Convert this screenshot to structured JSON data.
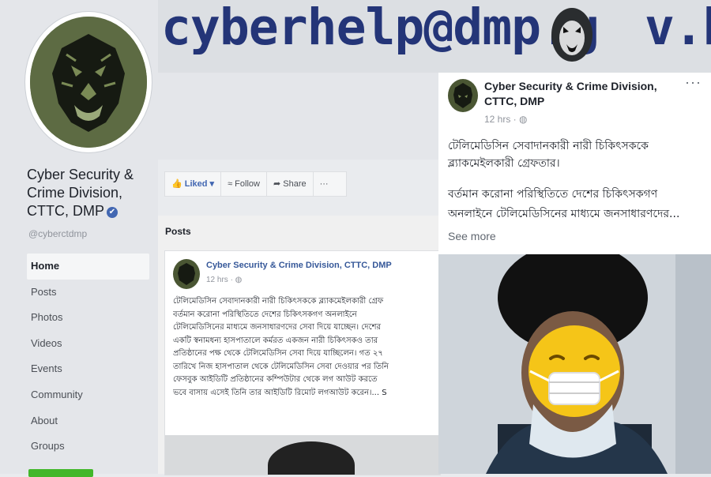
{
  "banner": {
    "email_before": "cyberhelp@dmp.g",
    "email_after": "v.bd"
  },
  "page": {
    "name": "Cyber Security & Crime Division, CTTC, DMP",
    "handle": "@cyberctdmp",
    "verified_glyph": "✔"
  },
  "nav": {
    "items": [
      "Home",
      "Posts",
      "Photos",
      "Videos",
      "Events",
      "Community",
      "About",
      "Groups"
    ],
    "active": "Home"
  },
  "actions": {
    "liked": "Liked ▾",
    "follow": "Follow",
    "share": "Share",
    "more": "···"
  },
  "posts_section": {
    "heading": "Posts",
    "post": {
      "author": "Cyber Security & Crime Division, CTTC, DMP",
      "time": "12 hrs · ◍",
      "body": "টেলিমেডিসিন সেবাদানকারী নারী চিকিৎসককে ব্ল্যাকমেইলকারী গ্রেফ\nবর্তমান করোনা পরিস্থিতিতে দেশের চিকিৎসকগণ অনলাইনে\nটেলিমেডিসিনের মাধ্যমে জনসাধারণদের সেবা দিয়ে যাচ্ছেন। দেশের\nএকটি স্বনামধন্য হাসপাতালে কর্মরত একজন নারী চিকিৎসকও তার\nপ্রতিষ্ঠানের পক্ষ থেকে টেলিমেডিসিন সেবা দিয়ে যাচ্ছিলেন। গত ২৭\nতারিখে নিজ হাসপাতাল থেকে টেলিমেডিসিন সেবা দেওয়ার পর তিনি\nফেসবুক আইডিটি প্রতিষ্ঠানের কম্পিউটার থেকে লগ আউট করতে\nভবে বাসায় এসেই তিনি তার আইডিটি রিমোট লগআউট করেন।... S"
    }
  },
  "main_post": {
    "author": "Cyber Security & Crime Division, CTTC, DMP",
    "more": "···",
    "time": "12 hrs · ◍",
    "headline": "টেলিমেডিসিন সেবাদানকারী নারী চিকিৎসককে ব্ল্যাকমেইলকারী গ্রেফতার।",
    "body": "বর্তমান করোনা পরিস্থিতিতে দেশের চিকিৎসকগণ\nঅনলাইনে টেলিমেডিসিনের মাধ্যমে জনসাধারণদের...",
    "see_more": "See more"
  },
  "colors": {
    "banner_text": "#243578",
    "link": "#365899",
    "avatar_bg": "#4a5633"
  }
}
